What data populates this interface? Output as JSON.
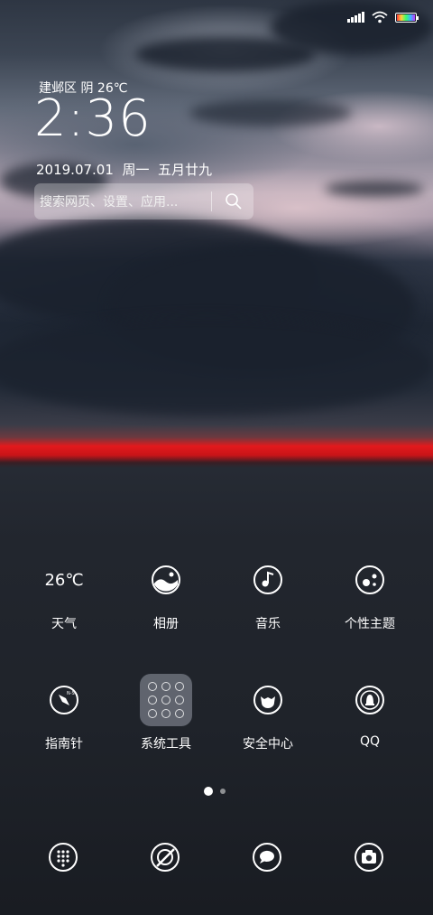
{
  "status_bar": {
    "icons": [
      "signal-icon",
      "wifi-icon",
      "battery-icon"
    ]
  },
  "clock_widget": {
    "location": "建邺区",
    "weather": "阴",
    "temperature": "26℃",
    "time": "2:36",
    "date": "2019.07.01",
    "weekday": "周一",
    "lunar_date": "五月廿九"
  },
  "search": {
    "placeholder": "搜索网页、设置、应用..."
  },
  "apps": [
    {
      "label": "天气",
      "icon_text": "26℃",
      "icon": "weather-icon"
    },
    {
      "label": "相册",
      "icon": "gallery-icon"
    },
    {
      "label": "音乐",
      "icon": "music-icon"
    },
    {
      "label": "个性主题",
      "icon": "themes-icon"
    },
    {
      "label": "指南针",
      "icon": "compass-icon"
    },
    {
      "label": "系统工具",
      "icon": "folder-icon"
    },
    {
      "label": "安全中心",
      "icon": "security-icon"
    },
    {
      "label": "QQ",
      "icon": "qq-icon"
    }
  ],
  "page_indicator": {
    "current": 1,
    "total": 2
  },
  "dock": [
    {
      "icon": "dialer-icon"
    },
    {
      "icon": "browser-icon"
    },
    {
      "icon": "messages-icon"
    },
    {
      "icon": "camera-icon"
    }
  ]
}
